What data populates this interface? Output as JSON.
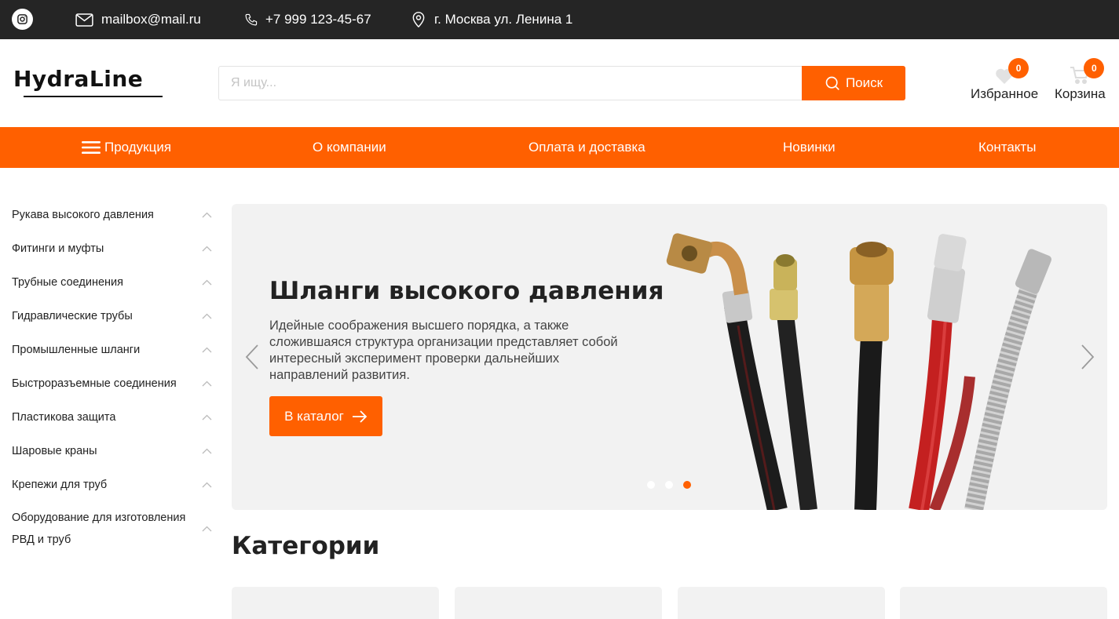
{
  "topbar": {
    "email": "mailbox@mail.ru",
    "phone": "+7 999 123-45-67",
    "address": "г. Москва ул. Ленина 1"
  },
  "header": {
    "logo_text": "HydraLine",
    "search_placeholder": "Я ищу...",
    "search_button": "Поиск",
    "favorites_label": "Избранное",
    "favorites_count": "0",
    "cart_label": "Корзина",
    "cart_count": "0"
  },
  "nav": {
    "items": [
      "Продукция",
      "О компании",
      "Оплата и доставка",
      "Новинки",
      "Контакты"
    ]
  },
  "sidebar": {
    "categories": [
      "Рукава высокого давления",
      "Фитинги и муфты",
      "Трубные соединения",
      "Гидравлические трубы",
      "Промышленные шланги",
      "Быстроразъемные соединения",
      "Пластикова защита",
      "Шаровые краны",
      "Крепежи для труб",
      "Оборудование для изготовления РВД и труб"
    ]
  },
  "slider": {
    "title": "Шланги высокого давления",
    "text": "Идейные соображения высшего порядка, а также сложившаяся структура организации представляет собой интересный эксперимент проверки дальнейших направлений развития.",
    "button": "В каталог",
    "slide_count": 3,
    "active_slide": 3
  },
  "categories_section": {
    "title": "Категории"
  },
  "colors": {
    "accent": "#ff6000",
    "topbar_bg": "#252525",
    "slider_bg": "#f2f2f2"
  }
}
